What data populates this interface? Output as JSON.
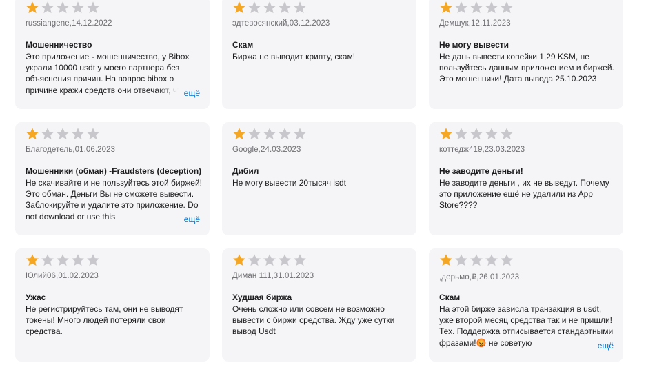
{
  "rating_colors": {
    "filled": "#f5a623",
    "empty": "#c7c7cc"
  },
  "more_label": "ещё",
  "reviews": [
    {
      "rating": 1,
      "author": "russiangene",
      "date": "14.12.2022",
      "meta": "russiangene,14.12.2022",
      "title": "Мошенничество",
      "body": "Это приложение - мошенничество, у Bibox украли 10000 usdt у моего партнера без объяснения причин. На вопрос bibox о причине кражи средств они отвечают, что",
      "has_more": true
    },
    {
      "rating": 1,
      "author": "эдтевосянский",
      "date": "03.12.2023",
      "meta": "эдтевосянский,03.12.2023",
      "title": "Скам",
      "body": "Биржа не выводит крипту, скам!",
      "has_more": false
    },
    {
      "rating": 1,
      "author": "Демшук",
      "date": "12.11.2023",
      "meta": "Демшук,12.11.2023",
      "title": "Не могу вывести",
      "body": "Не дань вывести копейки 1,29 KSM, не пользуйтесь данным приложением и биржей. Это мошенники! Дата вывода 25.10.2023",
      "has_more": false
    },
    {
      "rating": 1,
      "author": "Благодетель",
      "date": "01.06.2023",
      "meta": "Благодетель,01.06.2023",
      "title": "Мошенники (обман) -Fraudsters (deception)",
      "body": "Не скачивайте и не пользуйтесь этой биржей! Это обман. Деньги Вы не сможете вывести. Заблокируйте и удалите это приложение. Do not download or use this",
      "has_more": true
    },
    {
      "rating": 1,
      "author": "Google",
      "date": "24.03.2023",
      "meta": "Google,24.03.2023",
      "title": "Дибил",
      "body": "Не могу вывести 20тысяч isdt",
      "has_more": false
    },
    {
      "rating": 1,
      "author": "коттедж419",
      "date": "23.03.2023",
      "meta": "коттедж419,23.03.2023",
      "title": "Не заводите деньги!",
      "body": "Не заводите деньги , их не выведут. Почему это приложение ещё не удалили из App Store????",
      "has_more": false
    },
    {
      "rating": 1,
      "author": "Юлий06",
      "date": "01.02.2023",
      "meta": "Юлий06,01.02.2023",
      "title": "Ужас",
      "body": "Не регистрируйтесь там, они не выводят токены! Много людей потеряли свои средства.",
      "has_more": false
    },
    {
      "rating": 1,
      "author": "Диман 111",
      "date": "31.01.2023",
      "meta": "Диман 111,31.01.2023",
      "title": "Худшая биржа",
      "body": "Очень сложно или совсем не возможно вывести с биржи средства. Жду уже сутки вывод Usdt",
      "has_more": false
    },
    {
      "rating": 1,
      "author": ",дерьмо,₽",
      "date": "26.01.2023",
      "meta": ",дерьмо,₽,26.01.2023",
      "title": "Скам",
      "body": "На этой бирже зависла транзакция в usdt, уже второй месяц средства так и не пришли! Тех. Поддержка отписывается стандартными фразами!😡 не советую",
      "has_more": true
    }
  ]
}
